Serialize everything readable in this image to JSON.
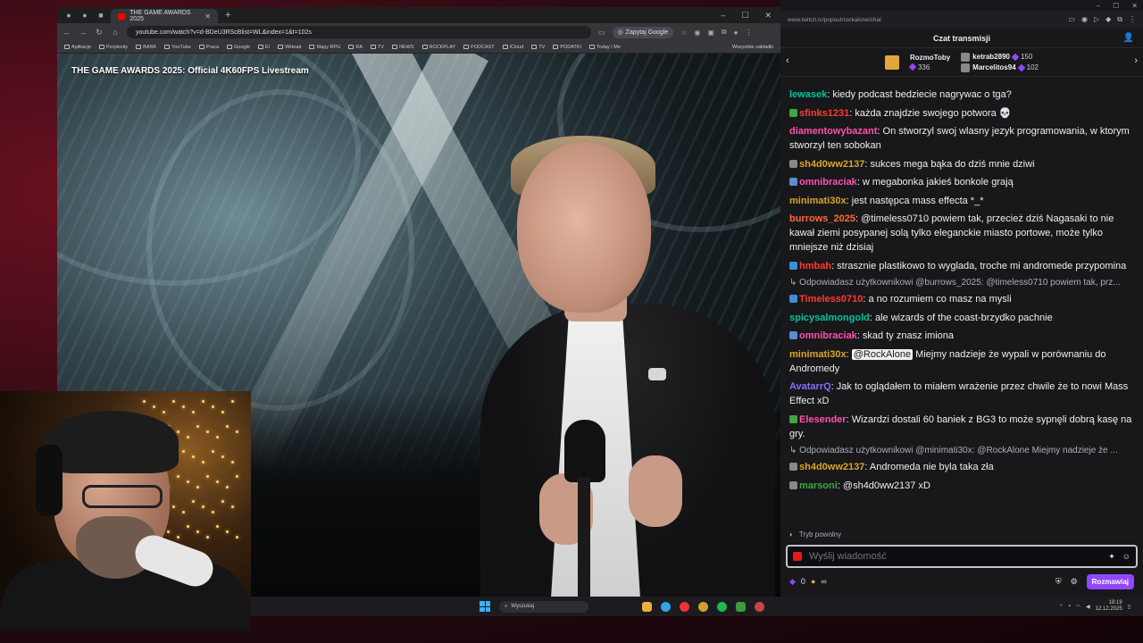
{
  "browser": {
    "tab_title": "THE GAME AWARDS 2025",
    "url": "youtube.com/watch?v=d-BDeU3RScBlist=WL&index=1&t=102s",
    "ask_google": "Zapytaj Google",
    "bookmarks": [
      "Aplikacje",
      "Perplexity",
      "BANK",
      "YouTube",
      "Praca",
      "Google",
      "EI",
      "WHead",
      "Mapy RPG",
      "RA",
      "TV",
      "NEWS",
      "ROCKPLAY",
      "PODCAST",
      "iCloud",
      "TV",
      "PODATKI",
      "Today / Me"
    ],
    "bookmarks_all": "Wszystkie zakładki"
  },
  "video": {
    "title": "THE GAME AWARDS 2025: Official 4K60FPS Livestream"
  },
  "taskbar": {
    "search_placeholder": "Wyszukaj",
    "time": "18:19",
    "date": "12.12.2025"
  },
  "chat": {
    "url": "www.twitch.tv/popout/rockalone/chat",
    "header": "Czat transmisji",
    "leaderboard": {
      "gifter_name": "RozmoToby",
      "gifter_count": "336",
      "top1_name": "ketrab2890",
      "top1_count": "150",
      "top2_name": "Marcelitos94",
      "top2_count": "102"
    },
    "messages": [
      {
        "user": "lewasek",
        "color": "#00c59b",
        "text": ": kiedy podcast bedziecie nagrywac o tga?",
        "badge": ""
      },
      {
        "user": "sfinks1231",
        "color": "#ff3a2f",
        "text": ": każda znajdzie swojego potwora 💀",
        "badge": "#3fa83f"
      },
      {
        "user": "diamentowybazant",
        "color": "#ff4fb0",
        "text": ": On stworzyl swoj wlasny jezyk programowania, w ktorym stworzyl ten sobokan",
        "badge": ""
      },
      {
        "user": "sh4d0ww2137",
        "color": "#daa520",
        "text": ": sukces mega bąka do dziś mnie dziwi",
        "badge": "#888888"
      },
      {
        "user": "omnibraciak",
        "color": "#ff4fb0",
        "text": ": w megabonka jakieś bonkole grają",
        "badge": "#5b8bd6"
      },
      {
        "user": "minimati30x",
        "color": "#daa520",
        "text": ": jest następca mass effecta *_*",
        "badge": ""
      },
      {
        "user": "burrows_2025",
        "color": "#ff6a2f",
        "text": ": @timeless0710 powiem tak, przecież dziś Nagasaki to nie kawał ziemi posypanej solą tylko eleganckie miasto portowe, może tylko mniejsze niż dzisiaj",
        "badge": ""
      },
      {
        "user": "hmbah",
        "color": "#ff3a2f",
        "text": ": strasznie plastikowo to wyglada, troche mi andromede przypomina",
        "badge": "#3b8fd6"
      }
    ],
    "reply1": "Odpowiadasz użytkownikowi @burrows_2025: @timeless0710 powiem tak, prz...",
    "messages2": [
      {
        "user": "Timeless0710",
        "color": "#ff3a2f",
        "text": ": a no rozumiem co masz na mysli",
        "badge": "#3b8fd6"
      },
      {
        "user": "spicysalmongold",
        "color": "#00c59b",
        "text": ": ale wizards of the coast-brzydko pachnie",
        "badge": ""
      },
      {
        "user": "omnibraciak",
        "color": "#ff4fb0",
        "text": ": skad ty znasz imiona",
        "badge": "#5b8bd6"
      }
    ],
    "mention_msg": {
      "user": "minimati30x",
      "color": "#daa520",
      "mention": "@RockAlone",
      "text": " Miejmy nadzieje że wypali w porównaniu do Andromedy"
    },
    "messages3": [
      {
        "user": "AvatarrQ",
        "color": "#8a6bff",
        "text": ": Jak to oglądałem to miałem wrażenie przez chwile że to nowi Mass Effect xD",
        "badge": ""
      },
      {
        "user": "Elesender",
        "color": "#ff4fb0",
        "text": ": Wizardzi dostali 60 baniek z BG3 to może sypnęli dobrą kasę na gry.",
        "badge": "#3fa83f"
      }
    ],
    "reply2": "Odpowiadasz użytkownikowi @minimati30x: @RockAlone Miejmy nadzieje że ...",
    "messages4": [
      {
        "user": "sh4d0ww2137",
        "color": "#daa520",
        "text": ": Andromeda nie byla taka zła",
        "badge": "#888888"
      },
      {
        "user": "marsoni",
        "color": "#3fa83f",
        "text": ": @sh4d0ww2137 xD",
        "badge": "#888888"
      }
    ],
    "slow_mode": "Tryb powolny",
    "input_placeholder": "Wyślij wiadomość",
    "bits_count": "0",
    "points": "∞",
    "send_label": "Rozmawiaj"
  }
}
